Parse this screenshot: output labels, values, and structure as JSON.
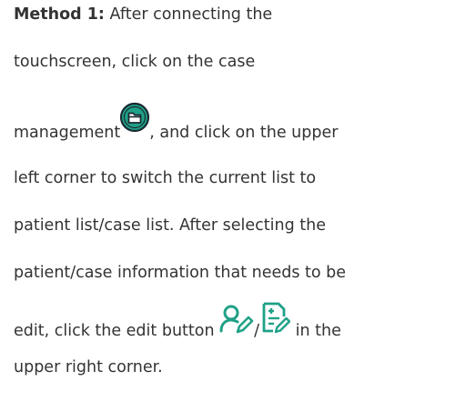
{
  "paragraph": {
    "label": "Method 1:",
    "line1_rest": " After connecting the",
    "line2": "touchscreen, click on the case",
    "line3_before": "management",
    "line3_after": ", and click on the upper",
    "line4": "left corner to switch the current list to",
    "line5": "patient list/case list. After selecting the",
    "line6": "patient/case information that needs to be",
    "line7_before": "edit, click the edit button ",
    "line7_separator": "/",
    "line7_after": " in the",
    "line8": "upper right corner."
  },
  "icons": {
    "case_management": "folder-circle-icon",
    "edit_patient": "edit-user-icon",
    "edit_case": "edit-document-icon",
    "accent_color": "#1fa187",
    "icon_dark": "#1b2a33"
  }
}
